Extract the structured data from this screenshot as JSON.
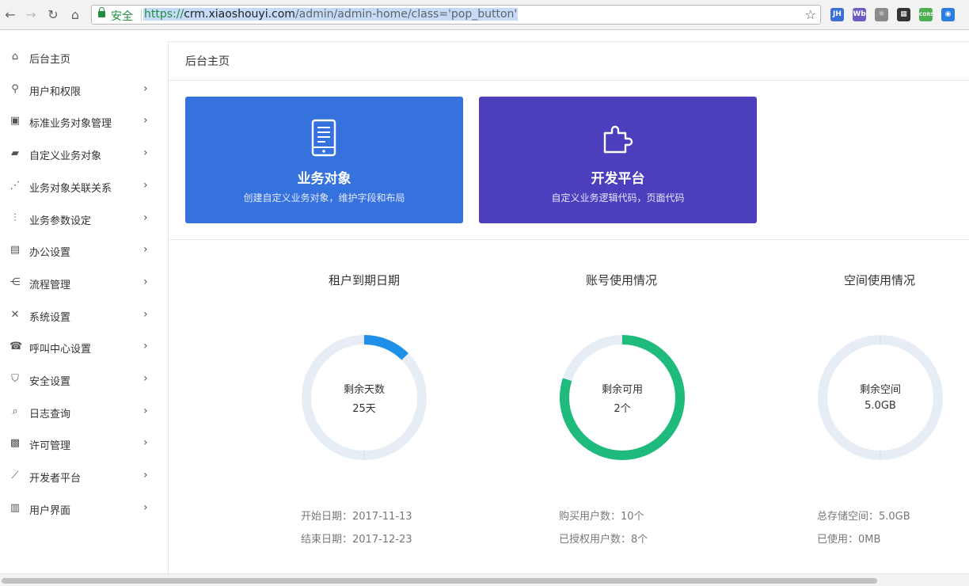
{
  "browser": {
    "back": "←",
    "forward": "→",
    "reload": "↻",
    "home": "⌂",
    "secure_label": "安全",
    "url_scheme": "https://",
    "url_host": "crm.xiaoshouyi.com",
    "url_path": "/admin/admin-home/class='pop_button'",
    "star": "☆",
    "extensions": [
      {
        "name": "jh",
        "label": "JH",
        "color": "#3b6fd8"
      },
      {
        "name": "wb",
        "label": "Wb",
        "color": "#6b5cc2"
      },
      {
        "name": "react",
        "label": "⚛",
        "color": "#8a8a8a"
      },
      {
        "name": "qr",
        "label": "▦",
        "color": "#333333"
      },
      {
        "name": "cors",
        "label": "CORS",
        "color": "#4caf50"
      },
      {
        "name": "globe",
        "label": "◉",
        "color": "#2a7de1"
      }
    ]
  },
  "sidebar": {
    "items": [
      {
        "label": "后台主页",
        "icon": "⌂",
        "icon_name": "home-icon",
        "has_children": false
      },
      {
        "label": "用户和权限",
        "icon": "⚲",
        "icon_name": "user-key-icon",
        "has_children": true
      },
      {
        "label": "标准业务对象管理",
        "icon": "▣",
        "icon_name": "briefcase-icon",
        "has_children": true
      },
      {
        "label": "自定义业务对象",
        "icon": "▰",
        "icon_name": "puzzle-icon",
        "has_children": true
      },
      {
        "label": "业务对象关联关系",
        "icon": "⋰",
        "icon_name": "relation-icon",
        "has_children": true
      },
      {
        "label": "业务参数设定",
        "icon": "⫶",
        "icon_name": "sliders-icon",
        "has_children": true
      },
      {
        "label": "办公设置",
        "icon": "▤",
        "icon_name": "document-icon",
        "has_children": true
      },
      {
        "label": "流程管理",
        "icon": "⋲",
        "icon_name": "flow-icon",
        "has_children": true
      },
      {
        "label": "系统设置",
        "icon": "✕",
        "icon_name": "tools-icon",
        "has_children": true
      },
      {
        "label": "呼叫中心设置",
        "icon": "☎",
        "icon_name": "headset-icon",
        "has_children": true
      },
      {
        "label": "安全设置",
        "icon": "⛉",
        "icon_name": "shield-icon",
        "has_children": true
      },
      {
        "label": "日志查询",
        "icon": "⌕",
        "icon_name": "log-search-icon",
        "has_children": true
      },
      {
        "label": "许可管理",
        "icon": "▩",
        "icon_name": "license-icon",
        "has_children": true
      },
      {
        "label": "开发者平台",
        "icon": "⟋",
        "icon_name": "chart-icon",
        "has_children": true
      },
      {
        "label": "用户界面",
        "icon": "▥",
        "icon_name": "layout-icon",
        "has_children": true
      }
    ],
    "chevron": "›"
  },
  "main": {
    "title": "后台主页",
    "cards": [
      {
        "title": "业务对象",
        "subtitle": "创建自定义业务对象，维护字段和布局",
        "icon": "tablet-icon",
        "color": "#3572dd"
      },
      {
        "title": "开发平台",
        "subtitle": "自定义业务逻辑代码，页面代码",
        "icon": "puzzle-icon",
        "color": "#4b3fbd"
      }
    ],
    "stats": [
      {
        "title": "租户到期日期",
        "ring_label": "剩余天数",
        "ring_value": "25天",
        "used_fraction": 0.125,
        "color": "#1e90e8",
        "lines": [
          "开始日期：2017-11-13",
          "结束日期：2017-12-23"
        ]
      },
      {
        "title": "账号使用情况",
        "ring_label": "剩余可用",
        "ring_value": "2个",
        "used_fraction": 0.8,
        "color": "#1fbb7d",
        "lines": [
          "购买用户数：10个",
          "已授权用户数：8个"
        ]
      },
      {
        "title": "空间使用情况",
        "ring_label": "剩余空间",
        "ring_value": "5.0GB",
        "used_fraction": 0,
        "color": "#1e90e8",
        "lines": [
          "总存储空间：5.0GB",
          "已使用：0MB"
        ]
      }
    ],
    "ring_track_color": "#e6edf5"
  }
}
